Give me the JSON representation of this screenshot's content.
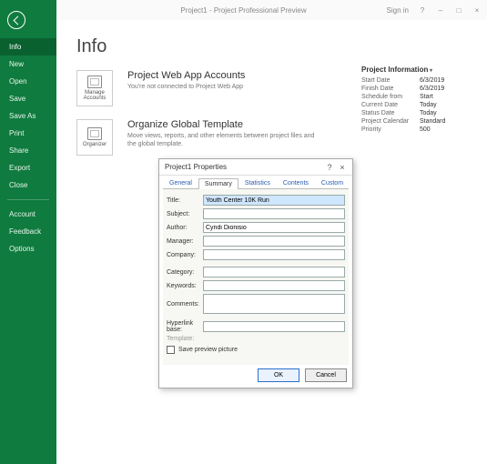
{
  "titlebar": {
    "doc": "Project1 - Project Professional Preview",
    "signin": "Sign in",
    "help": "?",
    "min": "–",
    "max": "□",
    "close": "×"
  },
  "sidebar": {
    "items": [
      "Info",
      "New",
      "Open",
      "Save",
      "Save As",
      "Print",
      "Share",
      "Export",
      "Close"
    ],
    "bottom": [
      "Account",
      "Feedback",
      "Options"
    ]
  },
  "main": {
    "title": "Info",
    "accounts": {
      "btn": "Manage Accounts",
      "heading": "Project Web App Accounts",
      "sub": "You're not connected to Project Web App"
    },
    "organize": {
      "btn": "Organizer",
      "heading": "Organize Global Template",
      "sub": "Move views, reports, and other elements between project files and the global template."
    }
  },
  "projinfo": {
    "heading": "Project Information",
    "rows": [
      {
        "k": "Start Date",
        "v": "6/3/2019"
      },
      {
        "k": "Finish Date",
        "v": "6/3/2019"
      },
      {
        "k": "Schedule from",
        "v": "Start"
      },
      {
        "k": "Current Date",
        "v": "Today"
      },
      {
        "k": "Status Date",
        "v": "Today"
      },
      {
        "k": "Project Calendar",
        "v": "Standard"
      },
      {
        "k": "Priority",
        "v": "500"
      }
    ]
  },
  "dialog": {
    "title": "Project1 Properties",
    "help": "?",
    "close": "×",
    "tabs": [
      "General",
      "Summary",
      "Statistics",
      "Contents",
      "Custom"
    ],
    "fields": {
      "title_l": "Title:",
      "title_v": "Youth Center 10K Run",
      "subject_l": "Subject:",
      "subject_v": "",
      "author_l": "Author:",
      "author_v": "Cyndi Dionisio",
      "manager_l": "Manager:",
      "manager_v": "",
      "company_l": "Company:",
      "company_v": "",
      "category_l": "Category:",
      "category_v": "",
      "keywords_l": "Keywords:",
      "keywords_v": "",
      "comments_l": "Comments:",
      "comments_v": "",
      "hyper_l": "Hyperlink base:",
      "hyper_v": "",
      "template_l": "Template:"
    },
    "check": "Save preview picture",
    "ok": "OK",
    "cancel": "Cancel"
  }
}
